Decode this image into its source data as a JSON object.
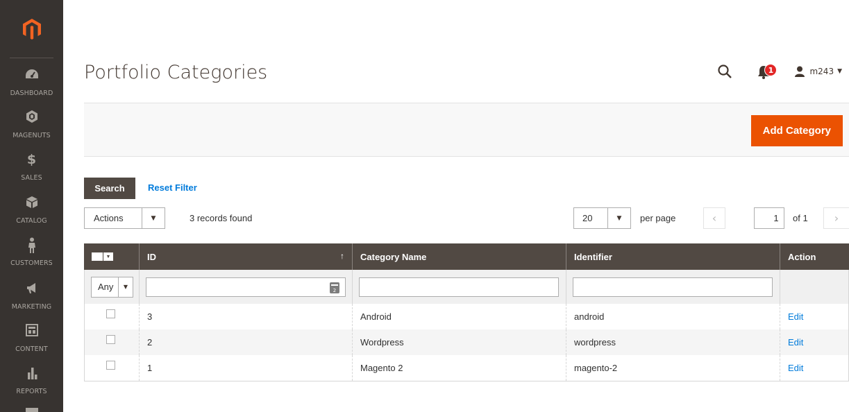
{
  "sidebar": {
    "items": [
      {
        "label": "DASHBOARD",
        "icon": "dashboard-icon"
      },
      {
        "label": "MAGENUTS",
        "icon": "hexagon-icon"
      },
      {
        "label": "SALES",
        "icon": "dollar-icon"
      },
      {
        "label": "CATALOG",
        "icon": "box-icon"
      },
      {
        "label": "CUSTOMERS",
        "icon": "person-icon"
      },
      {
        "label": "MARKETING",
        "icon": "megaphone-icon"
      },
      {
        "label": "CONTENT",
        "icon": "layout-icon"
      },
      {
        "label": "REPORTS",
        "icon": "bar-chart-icon"
      }
    ]
  },
  "header": {
    "title": "Portfolio Categories",
    "notifications_count": "1",
    "username": "m243"
  },
  "page_actions": {
    "add_label": "Add Category"
  },
  "filters": {
    "search_label": "Search",
    "reset_label": "Reset Filter"
  },
  "toolbar": {
    "actions_label": "Actions",
    "records_found": "3 records found",
    "per_page_value": "20",
    "per_page_label": "per page",
    "current_page": "1",
    "of_pages": "of 1"
  },
  "grid": {
    "columns": [
      "ID",
      "Category Name",
      "Identifier",
      "Action"
    ],
    "any_filter": "Any",
    "rows": [
      {
        "id": "3",
        "name": "Android",
        "identifier": "android",
        "action": "Edit"
      },
      {
        "id": "2",
        "name": "Wordpress",
        "identifier": "wordpress",
        "action": "Edit"
      },
      {
        "id": "1",
        "name": "Magento 2",
        "identifier": "magento-2",
        "action": "Edit"
      }
    ]
  },
  "colors": {
    "sidebar_bg": "#373330",
    "accent": "#eb5202",
    "header_bg": "#514943",
    "link": "#007bdb",
    "badge": "#e22626"
  }
}
